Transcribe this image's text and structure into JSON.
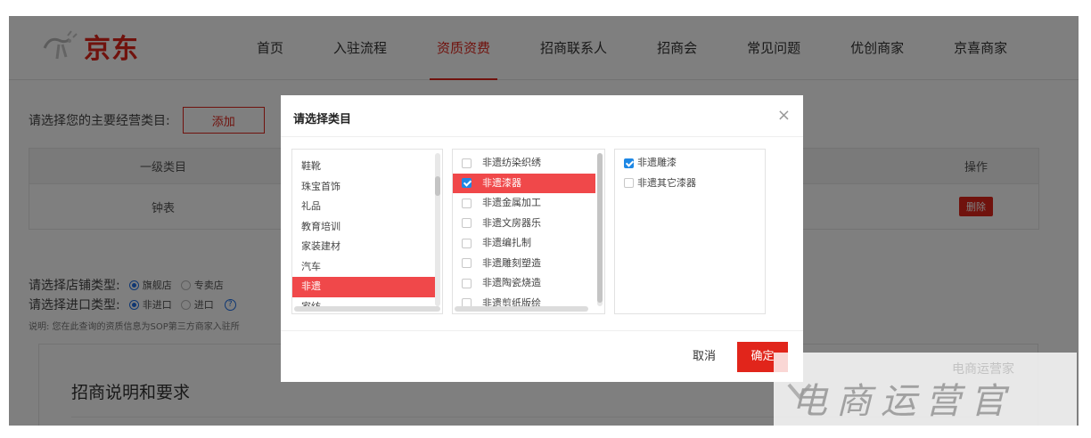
{
  "header": {
    "logo_text": "京东",
    "nav": [
      {
        "label": "首页",
        "active": false
      },
      {
        "label": "入驻流程",
        "active": false
      },
      {
        "label": "资质资费",
        "active": true
      },
      {
        "label": "招商联系人",
        "active": false
      },
      {
        "label": "招商会",
        "active": false
      },
      {
        "label": "常见问题",
        "active": false
      },
      {
        "label": "优创商家",
        "active": false
      },
      {
        "label": "京喜商家",
        "active": false
      }
    ]
  },
  "main": {
    "category_prompt": "请选择您的主要经营类目:",
    "add_button": "添加",
    "table": {
      "col_level1": "一级类目",
      "col_operation": "操作",
      "rows": [
        {
          "level1": "钟表",
          "delete": "删除"
        }
      ]
    },
    "store_type": {
      "label": "请选择店铺类型:",
      "options": [
        "旗舰店",
        "专卖店"
      ]
    },
    "import_type": {
      "label": "请选择进口类型:",
      "options": [
        "非进口",
        "进口"
      ]
    },
    "note": "说明: 您在此查询的资质信息为SOP第三方商家入驻所",
    "requirements_title": "招商说明和要求"
  },
  "modal": {
    "title": "请选择类目",
    "close": "×",
    "col1": [
      "鞋靴",
      "珠宝首饰",
      "礼品",
      "教育培训",
      "家装建材",
      "汽车",
      "非遗",
      "家纺"
    ],
    "col1_selected": 6,
    "col2": [
      {
        "label": "非遗纺染织绣",
        "checked": false
      },
      {
        "label": "非遗漆器",
        "checked": true
      },
      {
        "label": "非遗金属加工",
        "checked": false
      },
      {
        "label": "非遗文房器乐",
        "checked": false
      },
      {
        "label": "非遗编扎制",
        "checked": false
      },
      {
        "label": "非遗雕刻塑造",
        "checked": false
      },
      {
        "label": "非遗陶瓷烧造",
        "checked": false
      },
      {
        "label": "非遗剪纸版绘",
        "checked": false
      }
    ],
    "col2_selected": 1,
    "col3": [
      {
        "label": "非遗雕漆",
        "checked": true
      },
      {
        "label": "非遗其它漆器",
        "checked": false
      }
    ],
    "cancel": "取消",
    "confirm": "确定"
  },
  "watermark": {
    "text": "电商运营官",
    "sub": "电商运营家"
  }
}
